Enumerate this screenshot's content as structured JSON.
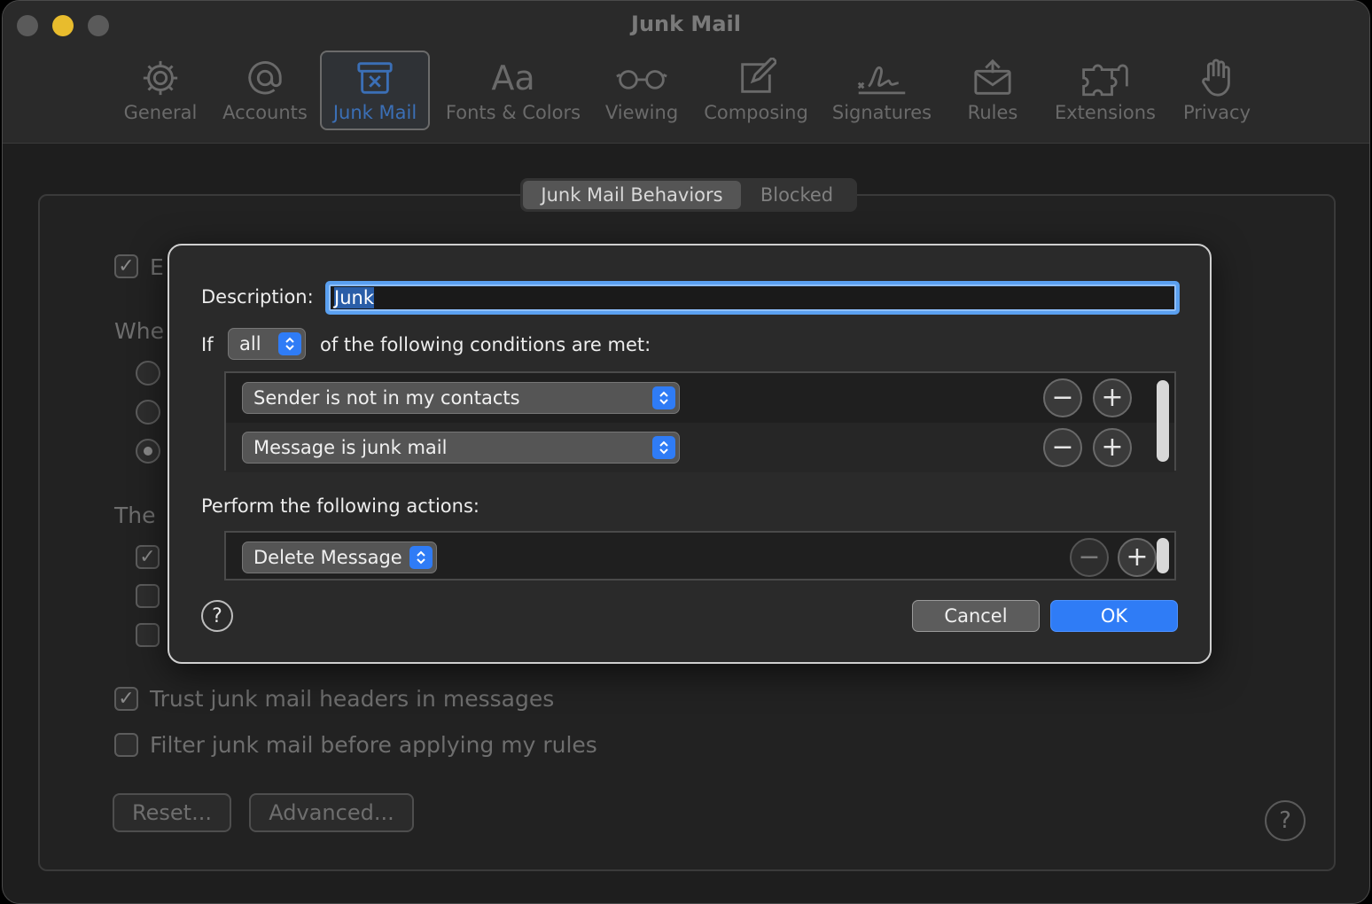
{
  "window": {
    "title": "Junk Mail"
  },
  "toolbar": {
    "items": [
      {
        "label": "General",
        "icon": "gear-icon"
      },
      {
        "label": "Accounts",
        "icon": "at-icon"
      },
      {
        "label": "Junk Mail",
        "icon": "junk-bin-icon"
      },
      {
        "label": "Fonts & Colors",
        "icon": "font-icon"
      },
      {
        "label": "Viewing",
        "icon": "glasses-icon"
      },
      {
        "label": "Composing",
        "icon": "compose-icon"
      },
      {
        "label": "Signatures",
        "icon": "signature-icon"
      },
      {
        "label": "Rules",
        "icon": "envelope-rules-icon"
      },
      {
        "label": "Extensions",
        "icon": "puzzle-icon"
      },
      {
        "label": "Privacy",
        "icon": "hand-icon"
      }
    ],
    "active": "Junk Mail",
    "font_glyph": "Aa"
  },
  "segments": {
    "behaviors": "Junk Mail Behaviors",
    "blocked": "Blocked",
    "selected": "Junk Mail Behaviors"
  },
  "background": {
    "enable_fragment": "E",
    "when_fragment": "Whe",
    "the_fragment": "The",
    "trust_headers": "Trust junk mail headers in messages",
    "filter_before_rules": "Filter junk mail before applying my rules",
    "reset_button": "Reset...",
    "advanced_button": "Advanced...",
    "help": "?"
  },
  "dialog": {
    "description_label": "Description:",
    "description_value": "Junk",
    "if_label": "If",
    "match_mode": "all",
    "conditions_label": "of the following conditions are met:",
    "conditions": [
      {
        "value": "Sender is not in my contacts"
      },
      {
        "value": "Message is junk mail"
      }
    ],
    "actions_label": "Perform the following actions:",
    "actions": [
      {
        "value": "Delete Message"
      }
    ],
    "minus": "−",
    "plus": "+",
    "help": "?",
    "cancel": "Cancel",
    "ok": "OK"
  }
}
